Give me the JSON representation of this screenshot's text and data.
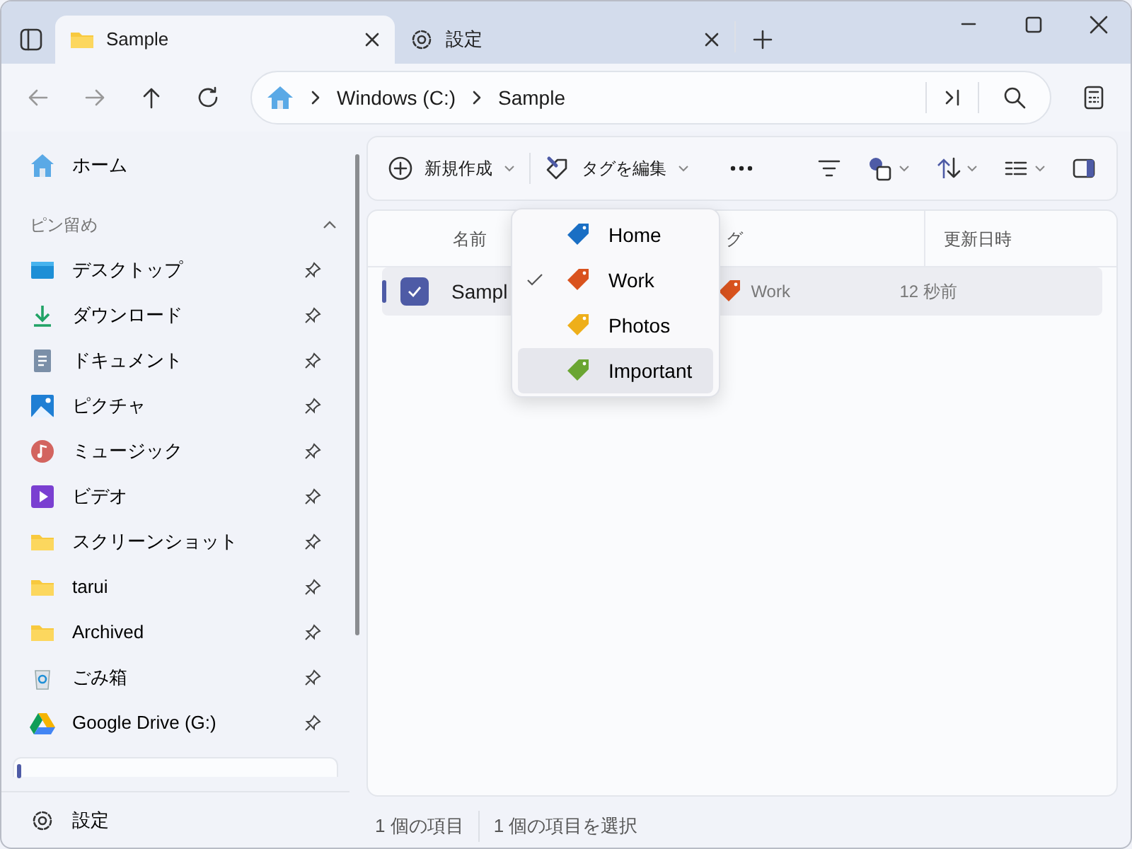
{
  "tabs": [
    {
      "label": "Sample",
      "kind": "folder",
      "selected": true
    },
    {
      "label": "設定",
      "kind": "gear",
      "selected": false
    }
  ],
  "address": {
    "crumbs": [
      "Windows (C:)",
      "Sample"
    ]
  },
  "sidebar": {
    "home": "ホーム",
    "section": "ピン留め",
    "section_expanded": true,
    "items": [
      {
        "label": "デスクトップ",
        "kind": "desktop"
      },
      {
        "label": "ダウンロード",
        "kind": "download"
      },
      {
        "label": "ドキュメント",
        "kind": "document"
      },
      {
        "label": "ピクチャ",
        "kind": "pictures"
      },
      {
        "label": "ミュージック",
        "kind": "music"
      },
      {
        "label": "ビデオ",
        "kind": "video"
      },
      {
        "label": "スクリーンショット",
        "kind": "folder"
      },
      {
        "label": "tarui",
        "kind": "folder"
      },
      {
        "label": "Archived",
        "kind": "folder"
      },
      {
        "label": "ごみ箱",
        "kind": "recycle"
      },
      {
        "label": "Google Drive (G:)",
        "kind": "drive"
      }
    ],
    "settings": "設定"
  },
  "toolbar": {
    "new": "新規作成",
    "edit_tags": "タグを編集"
  },
  "file_list": {
    "columns": [
      "名前",
      "グ",
      "更新日時"
    ],
    "rows": [
      {
        "name": "Sampl",
        "tag": "Work",
        "modified": "12 秒前",
        "selected": true
      }
    ]
  },
  "tag_menu": {
    "items": [
      {
        "label": "Home",
        "color": "#1a6fc4",
        "checked": false,
        "selected": false
      },
      {
        "label": "Work",
        "color": "#d9531e",
        "checked": true,
        "selected": false
      },
      {
        "label": "Photos",
        "color": "#eeaf1a",
        "checked": false,
        "selected": false
      },
      {
        "label": "Important",
        "color": "#6aa532",
        "checked": false,
        "selected": true
      }
    ]
  },
  "status_bar": [
    "1 個の項目",
    "1 個の項目を選択"
  ]
}
